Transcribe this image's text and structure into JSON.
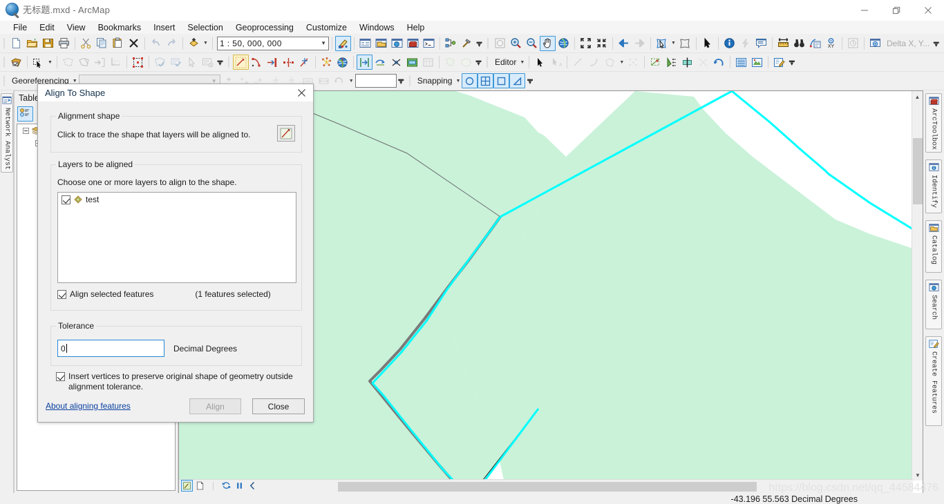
{
  "window": {
    "title": "无标题.mxd - ArcMap",
    "icon": "arcmap-globe-icon",
    "minimize": "—",
    "maximize": "❐",
    "close": "✕"
  },
  "menubar": {
    "items": [
      "File",
      "Edit",
      "View",
      "Bookmarks",
      "Insert",
      "Selection",
      "Geoprocessing",
      "Customize",
      "Windows",
      "Help"
    ]
  },
  "standard_toolbar": {
    "scale_value": "1 : 50, 000, 000",
    "buttons": [
      "new-document-icon",
      "open-folder-icon",
      "save-icon",
      "print-icon",
      "cut-scissors-icon",
      "copy-icon",
      "paste-icon",
      "delete-x-icon",
      "undo-arrow-icon",
      "redo-arrow-icon",
      "add-data-icon",
      "editor-toolbar-icon",
      "table-of-contents-icon",
      "catalog-window-icon",
      "search-window-icon",
      "arctoolbox-icon",
      "python-window-icon",
      "model-builder-icon",
      "customize-hammer-icon"
    ]
  },
  "tools_toolbar": {
    "buttons": [
      "zoom-previous-extent-icon",
      "zoom-in-icon",
      "zoom-out-icon",
      "pan-hand-icon",
      "full-extent-globe-icon",
      "fixed-zoom-in-icon",
      "fixed-zoom-out-icon",
      "go-back-extent-icon",
      "go-forward-extent-icon",
      "select-features-icon",
      "clear-selection-icon",
      "select-elements-icon",
      "identify-icon",
      "hyperlink-icon",
      "html-popup-icon",
      "measure-icon",
      "find-binoculars-icon",
      "find-route-icon",
      "go-to-xy-icon",
      "time-slider-icon",
      "create-viewer-window-icon"
    ],
    "delta_label": "Delta X, Y..."
  },
  "editor_toolbar": {
    "menu_label": "Editor",
    "buttons": [
      "edit-tool-arrow-icon",
      "edit-annotation-icon",
      "straight-segment-icon",
      "curve-segment-icon",
      "trace-icon",
      "point-icon",
      "split-tool-icon",
      "rotate-tool-icon",
      "sketch-properties-icon",
      "attributes-icon",
      "create-features-window-icon",
      "construction-tools-icon"
    ]
  },
  "topology_toolbar": {
    "buttons": [
      "topology-icon",
      "map-topology-icon",
      "select-topology-icon",
      "show-shared-features-icon",
      "construct-features-icon",
      "planarize-lines-icon",
      "validate-topology-icon",
      "error-inspector-icon",
      "fix-topology-error-icon"
    ]
  },
  "advanced_editing_toolbar": {
    "buttons": [
      "align-to-shape-icon",
      "replace-geometry-icon",
      "extend-trim-icon",
      "explode-icon",
      "generalize-icon",
      "smooth-icon",
      "construct-geodetic-icon",
      "copy-parallel-icon",
      "clip-icon",
      "buffer-icon",
      "union-icon",
      "merge-icon"
    ]
  },
  "georeferencing_toolbar": {
    "menu_label": "Georeferencing",
    "layer_combo_value": "",
    "link_textbox_value": ""
  },
  "snapping_toolbar": {
    "menu_label": "Snapping",
    "buttons": [
      "point-snapping-icon",
      "vertex-snapping-icon",
      "edge-snapping-icon",
      "end-snapping-icon"
    ]
  },
  "left_dock": {
    "tabs": [
      {
        "label": "Network Analyst",
        "icon": "network-analyst-icon"
      }
    ]
  },
  "toc": {
    "title": "Table",
    "tool_icons": [
      "list-by-drawing-order-icon",
      "list-by-source-icon"
    ],
    "tree": [
      {
        "label": "",
        "icon": "layers-data-frame-icon",
        "depth": 0
      },
      {
        "label": "",
        "icon": "feature-layer-icon",
        "depth": 1
      }
    ]
  },
  "right_dock": {
    "tabs": [
      {
        "label": "ArcToolbox",
        "icon": "arctoolbox-icon"
      },
      {
        "label": "Identify",
        "icon": "identify-icon"
      },
      {
        "label": "Catalog",
        "icon": "catalog-icon"
      },
      {
        "label": "Search",
        "icon": "search-icon"
      },
      {
        "label": "Create Features",
        "icon": "create-features-icon"
      }
    ]
  },
  "map": {
    "background_color": "#ffffff",
    "polygon_fill": "#c9f2d9",
    "selection_color": "#00ffff",
    "traced_shape_color": "#7a7a7a",
    "draw_tools": [
      "drawing-toolbar-icon",
      "page-layout-icon",
      "refresh-icon",
      "pause-icon",
      "back-arrow-icon"
    ]
  },
  "status": {
    "coordinates": "-43.196  55.563 Decimal Degrees",
    "watermark": "https://blog.csdn.net/qq_44584476"
  },
  "dialog": {
    "title": "Align To Shape",
    "close_icon": "close-icon",
    "alignment_shape": {
      "legend": "Alignment shape",
      "hint": "Click to trace the shape that layers will be aligned to.",
      "trace_button_icon": "trace-shape-icon"
    },
    "layers_to_align": {
      "legend": "Layers to be aligned",
      "hint": "Choose one or more layers to align to the shape.",
      "layers": [
        {
          "name": "test",
          "checked": true,
          "icon": "polygon-layer-icon"
        }
      ],
      "align_selected_label": "Align selected features",
      "align_selected_checked": true,
      "selected_count_text": "(1 features selected)"
    },
    "tolerance": {
      "legend": "Tolerance",
      "value": "0",
      "units": "Decimal Degrees"
    },
    "insert_vertices": {
      "label": "Insert vertices to preserve original shape of geometry outside alignment tolerance.",
      "checked": true
    },
    "about_link": "About aligning features",
    "align_button": "Align",
    "close_button": "Close"
  }
}
